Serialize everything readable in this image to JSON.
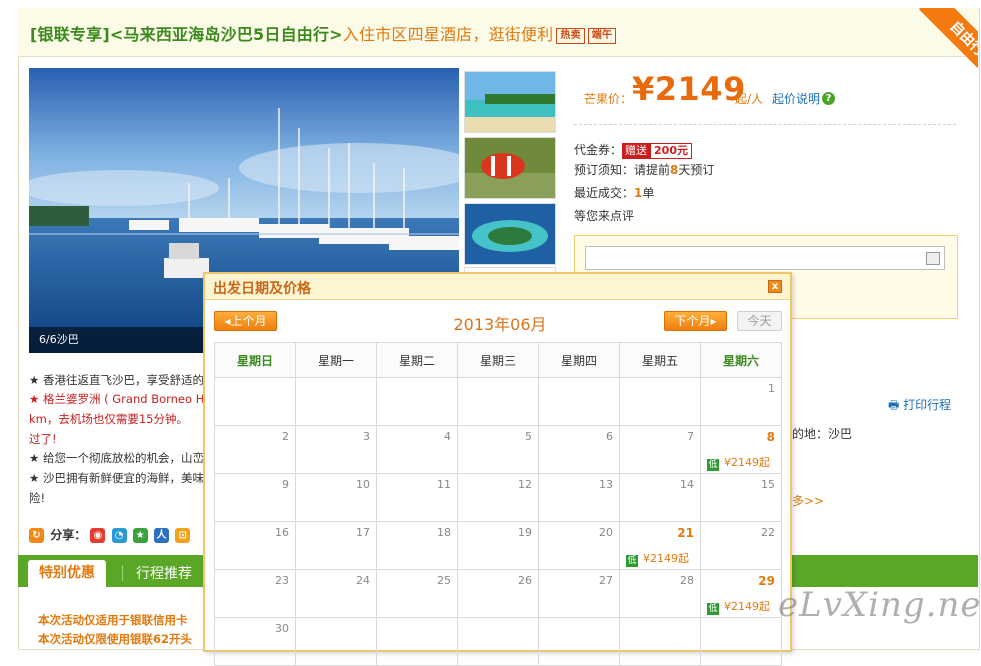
{
  "header": {
    "title_part1": "[银联专享]<马来西亚海岛沙巴5日自由行>",
    "title_part2": "入住市区四星酒店，逛街便利",
    "tag_hot": "热卖",
    "tag_other": "端午",
    "ribbon": "自由行"
  },
  "gallery": {
    "caption": "6/6沙巴"
  },
  "price": {
    "label": "芒果价：",
    "amount": "¥2149",
    "per": "起/人",
    "note": "起价说明",
    "help": "?"
  },
  "info": {
    "coupon_label": "代金券：",
    "coupon_badge": "赠送",
    "coupon_amount": "200元",
    "notice_label": "预订须知：",
    "notice_pre": "请提前",
    "notice_days": "8",
    "notice_post": "天预订",
    "recent_label": "最近成交：",
    "recent_count": "1",
    "recent_unit": "单",
    "review": "等您来点评"
  },
  "side": {
    "print": "打印行程",
    "dest": "的地：沙巴",
    "more": "多>>"
  },
  "description": {
    "line1": "★ 香港往返直飞沙巴，享受舒适的",
    "line2": "★ 格兰婆罗洲 ( Grand Borneo H",
    "line3": "km，去机场也仅需要15分钟。 ",
    "line4": "过了!",
    "line5": "★ 给您一个彻底放松的机会，山峦",
    "line6": "★ 沙巴拥有新鲜便宜的海鲜，美味",
    "line7": "险!"
  },
  "share": {
    "label": "分享："
  },
  "tabs": {
    "active": "特别优惠",
    "second": "行程推荐"
  },
  "bottom": {
    "line1": "本次活动仅适用于银联信用卡",
    "line2": "本次活动仅限使用银联62开头"
  },
  "watermark": "eLvXing.net",
  "calendar": {
    "title": "出发日期及价格",
    "close": "x",
    "prev": "◂上个月",
    "next": "下个月▸",
    "today": "今天",
    "month": "2013年06月",
    "weekdays": [
      "星期日",
      "星期一",
      "星期二",
      "星期三",
      "星期四",
      "星期五",
      "星期六"
    ],
    "low_badge": "低",
    "weeks": [
      [
        {
          "d": ""
        },
        {
          "d": ""
        },
        {
          "d": ""
        },
        {
          "d": ""
        },
        {
          "d": ""
        },
        {
          "d": ""
        },
        {
          "d": "1"
        }
      ],
      [
        {
          "d": "2"
        },
        {
          "d": "3"
        },
        {
          "d": "4"
        },
        {
          "d": "5"
        },
        {
          "d": "6"
        },
        {
          "d": "7"
        },
        {
          "d": "8",
          "p": "¥2149起"
        }
      ],
      [
        {
          "d": "9"
        },
        {
          "d": "10"
        },
        {
          "d": "11"
        },
        {
          "d": "12"
        },
        {
          "d": "13"
        },
        {
          "d": "14"
        },
        {
          "d": "15"
        }
      ],
      [
        {
          "d": "16"
        },
        {
          "d": "17"
        },
        {
          "d": "18"
        },
        {
          "d": "19"
        },
        {
          "d": "20"
        },
        {
          "d": "21",
          "p": "¥2149起"
        },
        {
          "d": "22"
        }
      ],
      [
        {
          "d": "23"
        },
        {
          "d": "24"
        },
        {
          "d": "25"
        },
        {
          "d": "26"
        },
        {
          "d": "27"
        },
        {
          "d": "28"
        },
        {
          "d": "29",
          "p": "¥2149起"
        }
      ],
      [
        {
          "d": "30"
        },
        {
          "d": ""
        },
        {
          "d": ""
        },
        {
          "d": ""
        },
        {
          "d": ""
        },
        {
          "d": ""
        },
        {
          "d": ""
        }
      ]
    ]
  },
  "colors": {
    "accent_orange": "#e86a0c",
    "brand_green": "#5aa727",
    "link_blue": "#1f6fb5"
  }
}
